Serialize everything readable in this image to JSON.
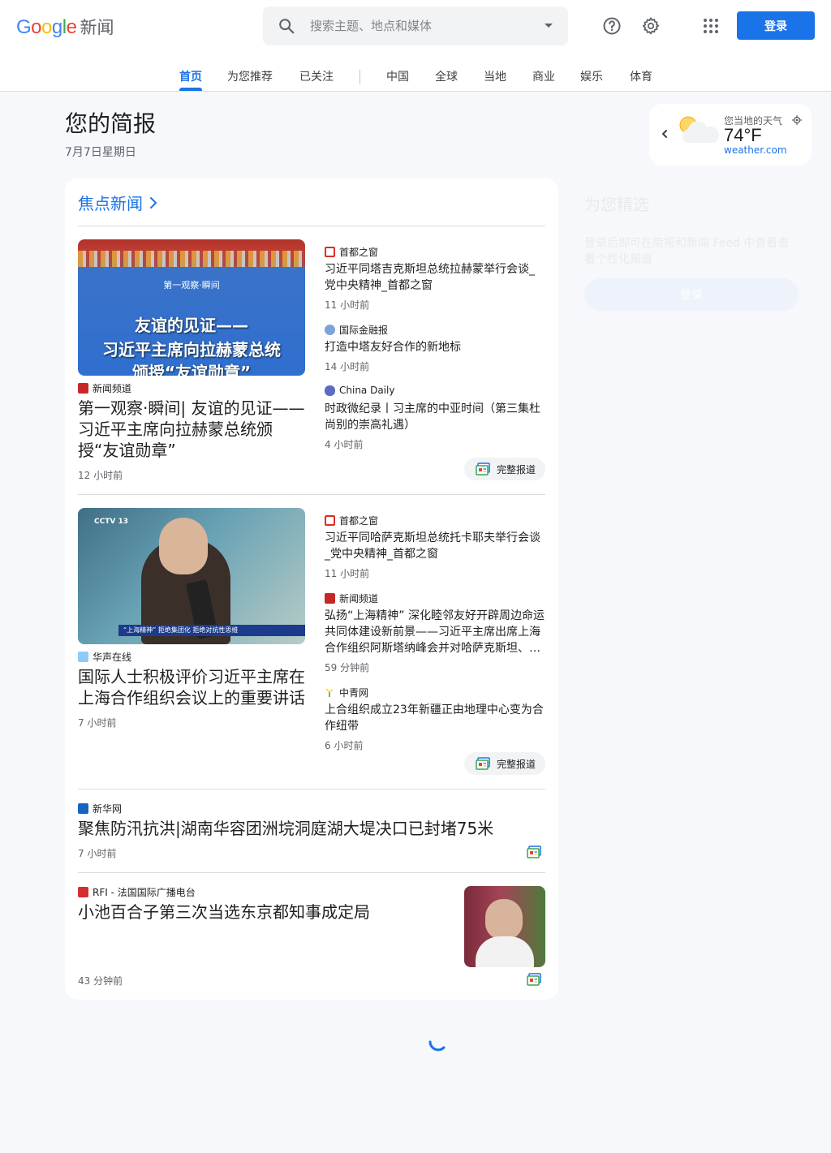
{
  "header": {
    "logo_text": "Google",
    "product": "新闻",
    "search_placeholder": "搜索主题、地点和媒体",
    "login_label": "登录"
  },
  "nav": {
    "tabs": [
      "首页",
      "为您推荐",
      "已关注",
      "中国",
      "全球",
      "当地",
      "商业",
      "娱乐",
      "体育"
    ],
    "active_index": 0
  },
  "briefing": {
    "title": "您的简报",
    "date": "7月7日星期日"
  },
  "weather": {
    "label": "您当地的天气",
    "temp": "74°F",
    "source": "weather.com",
    "icon": "partly-cloudy-icon"
  },
  "top_stories": {
    "title": "焦点新闻",
    "full_coverage_label": "完整报道",
    "clusters": [
      {
        "main": {
          "source": "新闻频道",
          "title": "第一观察·瞬间| 友谊的见证——习近平主席向拉赫蒙总统颁授“友谊勋章”",
          "time": "12 小时前",
          "image_caption_top": "第一观察·瞬间",
          "image_text_line1": "友谊的见证——",
          "image_text_line2": "习近平主席向拉赫蒙总统",
          "image_text_line3": "颁授“友谊勋章”"
        },
        "related": [
          {
            "source": "首都之窗",
            "title": "习近平同塔吉克斯坦总统拉赫蒙举行会谈_党中央精神_首都之窗",
            "time": "11 小时前"
          },
          {
            "source": "国际金融报",
            "title": "打造中塔友好合作的新地标",
            "time": "14 小时前"
          },
          {
            "source": "China Daily",
            "title": "时政微纪录丨习主席的中亚时间（第三集杜尚别的崇高礼遇）",
            "time": "4 小时前"
          }
        ]
      },
      {
        "main": {
          "source": "华声在线",
          "title": "国际人士积极评价习近平主席在上海合作组织会议上的重要讲话",
          "time": "7 小时前",
          "image_logo": "CCTV 13",
          "image_caption": "“上海精神” 拒绝集团化 拒绝对抗性思维"
        },
        "related": [
          {
            "source": "首都之窗",
            "title": "习近平同哈萨克斯坦总统托卡耶夫举行会谈_党中央精神_首都之窗",
            "time": "11 小时前"
          },
          {
            "source": "新闻频道",
            "title": "弘扬“上海精神” 深化睦邻友好开辟周边命运共同体建设新前景——习近平主席出席上海合作组织阿斯塔纳峰会并对哈萨克斯坦、…",
            "time": "59 分钟前"
          },
          {
            "source": "中青网",
            "title": "上合组织成立23年新疆正由地理中心变为合作纽带",
            "time": "6 小时前"
          }
        ]
      }
    ],
    "singles": [
      {
        "source": "新华网",
        "title": "聚焦防汛抗洪|湖南华容团洲垸洞庭湖大堤决口已封堵75米",
        "time": "7 小时前"
      },
      {
        "source": "RFI - 法国国际广播电台",
        "title": "小池百合子第三次当选东京都知事成定局",
        "time": "43 分钟前"
      }
    ]
  },
  "for_you": {
    "title": "为您精选",
    "text": "登录后即可在简报和新闻 Feed 中查看查看个性化报道",
    "button": "登录"
  },
  "colors": {
    "accent": "#1a73e8",
    "background": "#f6f8fc",
    "card": "#ffffff"
  }
}
